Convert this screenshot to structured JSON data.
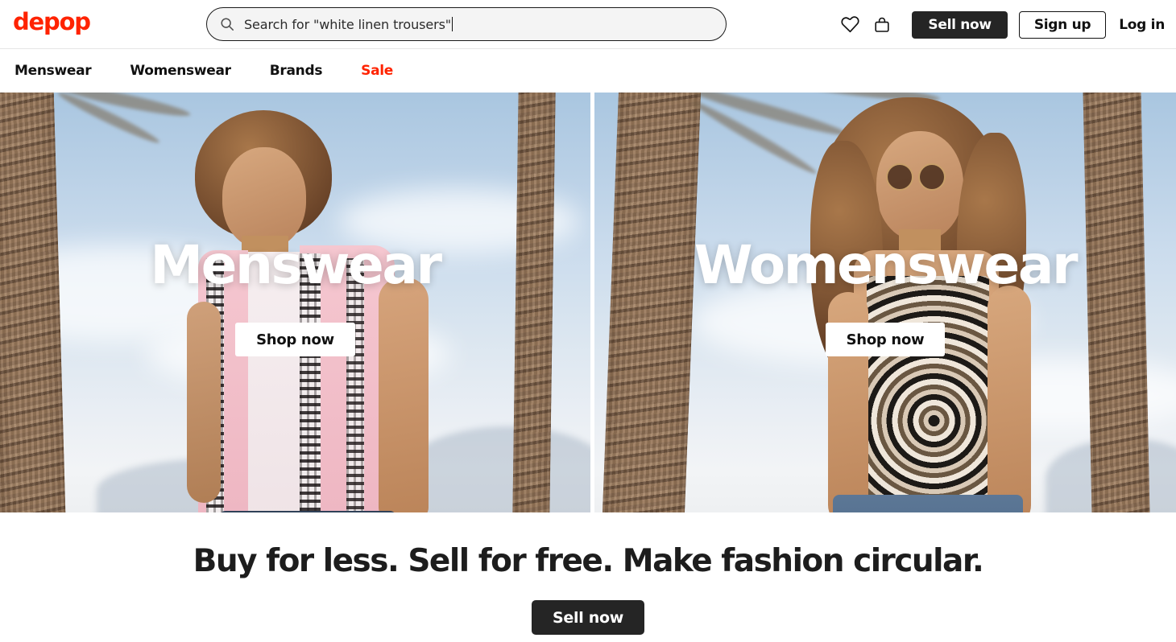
{
  "brand": {
    "logo_text": "depop",
    "logo_color": "#ff2300",
    "accent_color": "#ff2300",
    "dark_color": "#252525"
  },
  "header": {
    "search": {
      "icon": "search-icon",
      "value": "Search for \"white linen trousers\"",
      "placeholder": "Search for \"white linen trousers\""
    },
    "actions": {
      "likes_icon": "heart-icon",
      "bag_icon": "shopping-bag-icon",
      "sell_now_label": "Sell now",
      "sign_up_label": "Sign up",
      "log_in_label": "Log in"
    }
  },
  "nav": {
    "items": [
      {
        "label": "Menswear",
        "highlight": false
      },
      {
        "label": "Womenswear",
        "highlight": false
      },
      {
        "label": "Brands",
        "highlight": false
      },
      {
        "label": "Sale",
        "highlight": true
      }
    ]
  },
  "hero": {
    "panels": [
      {
        "title": "Menswear",
        "cta_label": "Shop now"
      },
      {
        "title": "Womenswear",
        "cta_label": "Shop now"
      }
    ]
  },
  "footer": {
    "tagline": "Buy for less. Sell for free. Make fashion circular.",
    "sell_now_label": "Sell now"
  }
}
